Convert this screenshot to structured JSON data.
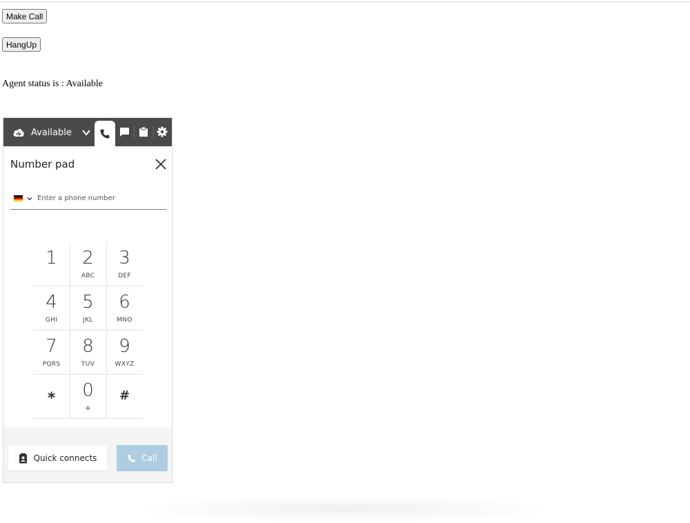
{
  "page": {
    "make_call_label": "Make Call",
    "hangup_label": "HangUp",
    "agent_status_text": "Agent status is : Available"
  },
  "softphone": {
    "status": {
      "label": "Available",
      "icon": "cloud-status-icon"
    },
    "tabs": [
      {
        "name": "phone",
        "icon": "phone-icon",
        "active": true
      },
      {
        "name": "chat",
        "icon": "chat-icon",
        "active": false
      },
      {
        "name": "tasks",
        "icon": "clipboard-icon",
        "active": false
      },
      {
        "name": "settings",
        "icon": "gear-icon",
        "active": false
      }
    ],
    "number_pad": {
      "title": "Number pad",
      "country_flag": "germany-flag-icon",
      "phone_placeholder": "Enter a phone number",
      "keys": [
        {
          "num": "1",
          "letters": ""
        },
        {
          "num": "2",
          "letters": "ABC"
        },
        {
          "num": "3",
          "letters": "DEF"
        },
        {
          "num": "4",
          "letters": "GHI"
        },
        {
          "num": "5",
          "letters": "JKL"
        },
        {
          "num": "6",
          "letters": "MNO"
        },
        {
          "num": "7",
          "letters": "PQRS"
        },
        {
          "num": "8",
          "letters": "TUV"
        },
        {
          "num": "9",
          "letters": "WXYZ"
        },
        {
          "num": "*",
          "letters": ""
        },
        {
          "num": "0",
          "letters": "+"
        },
        {
          "num": "#",
          "letters": ""
        }
      ]
    },
    "footer": {
      "quick_connects_label": "Quick connects",
      "call_label": "Call"
    },
    "colors": {
      "topbar": "#4a4a4a",
      "call_button": "#aecde0"
    }
  }
}
